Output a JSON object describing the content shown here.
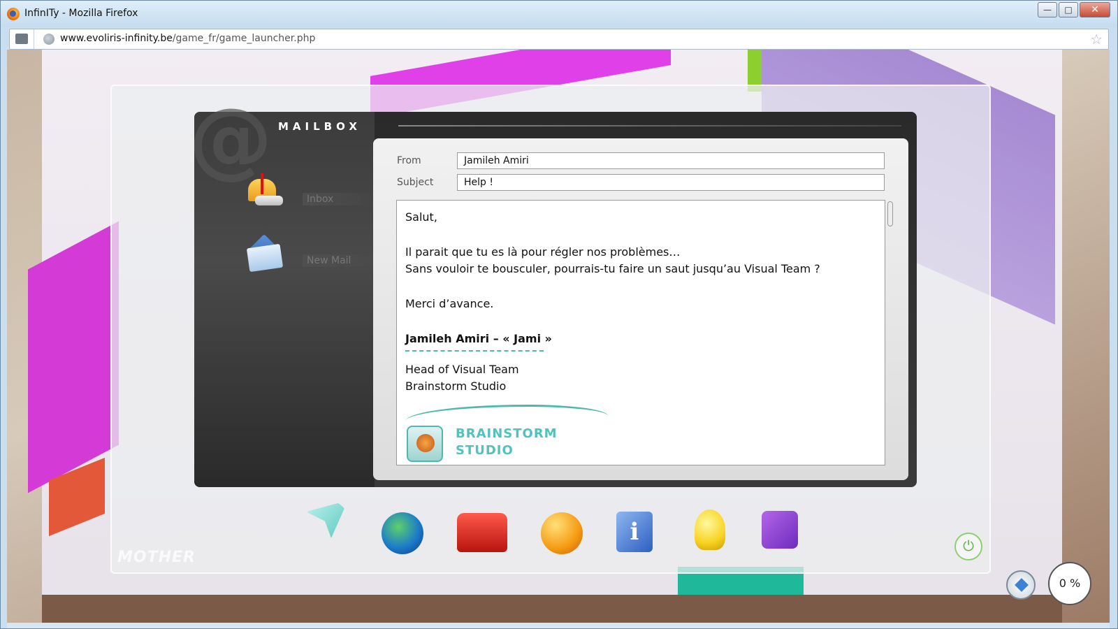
{
  "window": {
    "title": "InfinITy - Mozilla Firefox",
    "buttons": {
      "minimize": "—",
      "maximize": "□",
      "close": "✕"
    }
  },
  "browser": {
    "url_host": "www.evoliris-infinity.be",
    "url_path": "/game_fr/game_launcher.php"
  },
  "mailbox": {
    "title": "MAILBOX",
    "side": {
      "inbox_label": "Inbox",
      "new_mail_label": "New Mail"
    },
    "fields": {
      "from_label": "From",
      "from_value": "Jamileh Amiri",
      "subject_label": "Subject",
      "subject_value": "Help !"
    },
    "body": {
      "greeting": "Salut,",
      "line1": "Il parait que tu es là pour régler nos problèmes…",
      "line2": "Sans vouloir te bousculer, pourrais-tu faire un saut jusqu’au Visual Team ?",
      "thanks": "Merci d’avance.",
      "signature_name": "Jamileh Amiri – « Jami »",
      "role": "Head of Visual Team",
      "company": "Brainstorm Studio",
      "logo_line1": "BRAINSTORM",
      "logo_line2": "STUDIO"
    }
  },
  "dock": {
    "mother_label": "MOTHER",
    "progress_label": "0 %",
    "info_glyph": "i",
    "power_glyph": "⏻"
  },
  "colors": {
    "accent_teal": "#4fb6b0",
    "mailbox_dark": "#2a2a2a",
    "magenta": "#d43bd6"
  }
}
